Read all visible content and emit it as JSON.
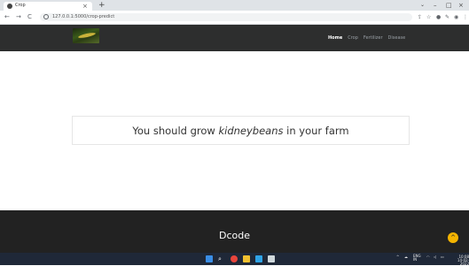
{
  "browser": {
    "tab_title": "Crop",
    "tab_close": "×",
    "new_tab": "+",
    "url": "127.0.0.1:5000/crop-predict",
    "nav": {
      "back": "←",
      "forward": "→",
      "reload": "C"
    },
    "window_controls": {
      "chevron": "⌄",
      "minimize": "–",
      "maximize": "□",
      "close": "×"
    }
  },
  "navbar": {
    "logo_alt": "site logo",
    "links": [
      "Home",
      "Crop",
      "Fertilizer",
      "Disease"
    ],
    "active_link": "Home"
  },
  "result": {
    "prefix": "You should grow ",
    "crop": "kidneybeans",
    "suffix": " in your farm"
  },
  "footer": {
    "brand": "Dcode",
    "scroll_top_icon": "^"
  },
  "taskbar": {
    "tray_lang": "ENG",
    "tray_region": "IN",
    "time": "10:08",
    "date": "14-02-2022"
  },
  "colors": {
    "navbar_bg": "#2d2e2e",
    "footer_bg": "#222222",
    "accent": "#f5b400",
    "taskbar_bg": "#1f2838"
  }
}
